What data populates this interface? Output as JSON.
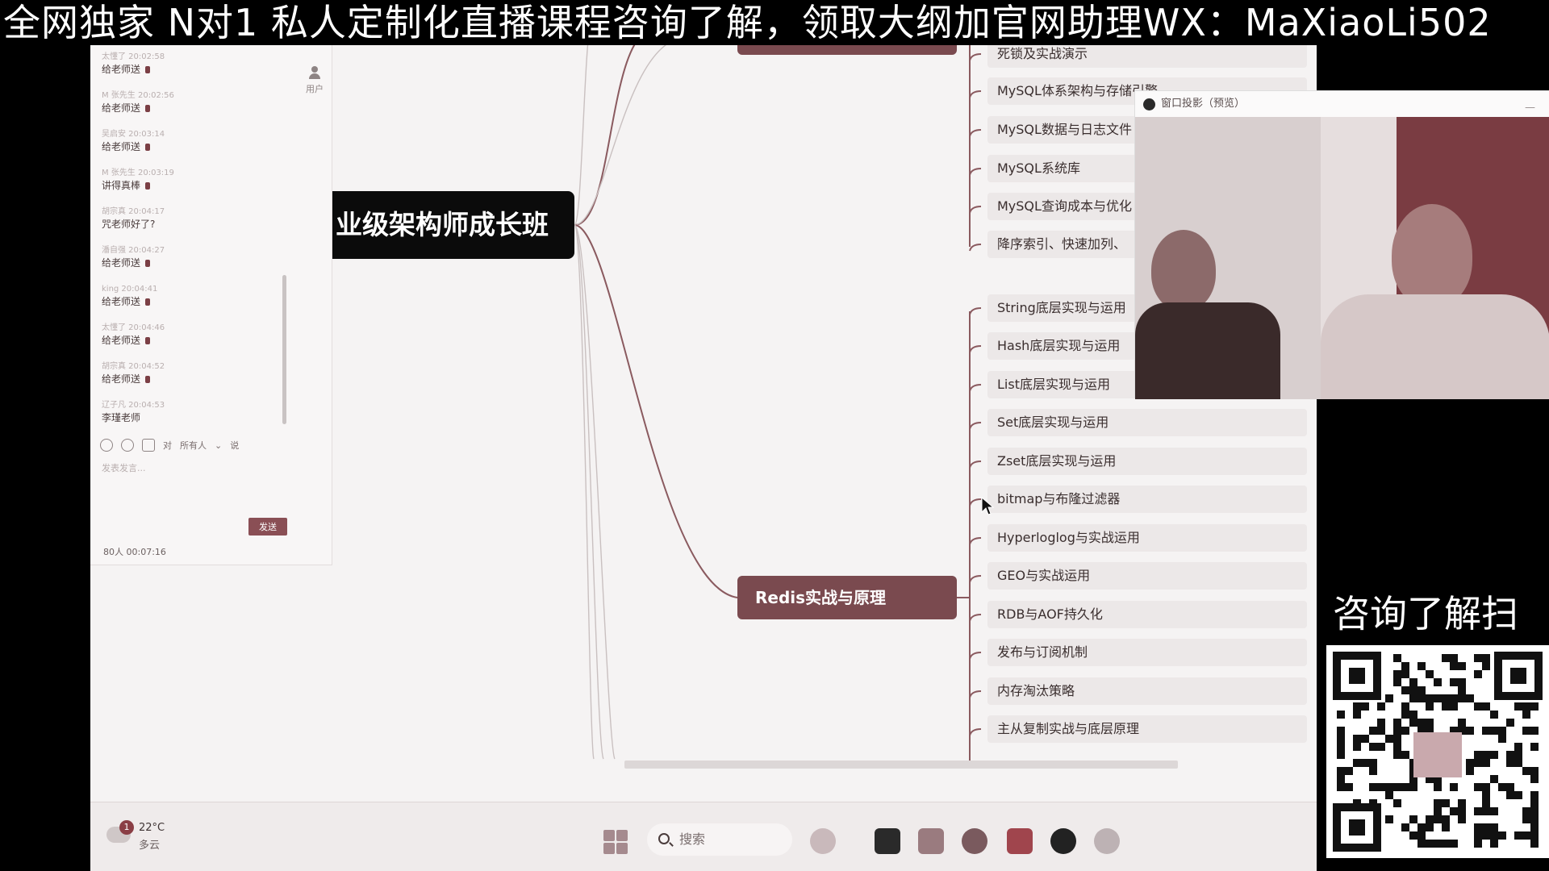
{
  "banner": {
    "text": "全网独家 N对1 私人定制化直播课程咨询了解，领取大纲加官网助理WX：MaXiaoLi502"
  },
  "chat": {
    "messages": [
      {
        "meta": "太懂了 20:02:58",
        "text": "给老师送"
      },
      {
        "meta": "M 张先生 20:02:56",
        "text": "给老师送"
      },
      {
        "meta": "吴启安 20:03:14",
        "text": "给老师送"
      },
      {
        "meta": "M 张先生 20:03:19",
        "text": "讲得真棒"
      },
      {
        "meta": "胡宗真 20:04:17",
        "text": "咒老师好了?"
      },
      {
        "meta": "潘自强 20:04:27",
        "text": "给老师送"
      },
      {
        "meta": "king 20:04:41",
        "text": "给老师送"
      },
      {
        "meta": "太懂了 20:04:46",
        "text": "给老师送"
      },
      {
        "meta": "胡宗真 20:04:52",
        "text": "给老师送"
      },
      {
        "meta": "辽子凡 20:04:53",
        "text": "李瑾老师"
      }
    ],
    "user_tab": "用户",
    "tools": {
      "to_label": "对",
      "audience": "所有人",
      "say": "说"
    },
    "input_placeholder": "发表发言...",
    "send_label": "发送",
    "footer": "80人 00:07:16"
  },
  "mindmap": {
    "root_label": "业级架构师成长班",
    "redis_label": "Redis实战与原理",
    "top_leaves": [
      "死锁及实战演示",
      "MySQL体系架构与存储引擎",
      "MySQL数据与日志文件",
      "MySQL系统库",
      "MySQL查询成本与优化",
      "降序索引、快速加列、"
    ],
    "redis_leaves": [
      "String底层实现与运用",
      "Hash底层实现与运用",
      "List底层实现与运用",
      "Set底层实现与运用",
      "Zset底层实现与运用",
      "bitmap与布隆过滤器",
      "Hyperloglog与实战运用",
      "GEO与实战运用",
      "RDB与AOF持久化",
      "发布与订阅机制",
      "内存淘汰策略",
      "主从复制实战与底层原理"
    ]
  },
  "taskbar": {
    "weather_temp": "22°C",
    "weather_cond": "多云",
    "weather_badge": "1",
    "search_label": "搜索",
    "apps": [
      "widgets-icon",
      "file-explorer-icon",
      "folder-icon",
      "browser-icon",
      "xmind-icon",
      "obs-icon",
      "cloud-icon"
    ]
  },
  "camera_window": {
    "title": "窗口投影（预览）",
    "min_label": "—"
  },
  "qr": {
    "title": "咨询了解扫"
  },
  "colors": {
    "accent": "#7a4a4f",
    "leaf_bg": "#ece8e8",
    "banner_bg": "#000000"
  }
}
